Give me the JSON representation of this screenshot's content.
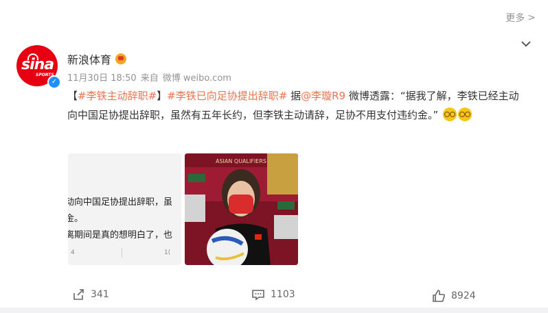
{
  "header": {
    "more_label": "更多",
    "more_chevron": ">"
  },
  "author": {
    "name": "新浪体育",
    "avatar_text": "sina",
    "avatar_subtext": "SPORTS",
    "avatar_color": "#e60012",
    "verified_icon": "verified-badge-icon"
  },
  "meta": {
    "time": "11月30日 18:50",
    "source_prefix": "来自",
    "source_app": "微博 weibo.com"
  },
  "content": {
    "part1": "【",
    "topic1": "#李铁主动辞职#",
    "part2": "】",
    "topic2": "#李铁已向足协提出辞职#",
    "part3": " 据",
    "mention": "@李璇R9",
    "part4": " 微博透露：“据我了解，李铁已经主动向中国足协提出辞职，虽然有五年长约，但李铁主动请辞，足协不用支付违约金。”",
    "link_color": "#eb7350"
  },
  "image1": {
    "lines": [
      "动向中国足协提出辞职，虽",
      "金。",
      "离期间是真的想明白了，也"
    ],
    "foot_left": "4",
    "foot_right": "1("
  },
  "image2": {
    "banner_text": "ASIAN QUALIFIERS"
  },
  "actions": {
    "share_count": "341",
    "comment_count": "1103",
    "like_count": "8924"
  }
}
